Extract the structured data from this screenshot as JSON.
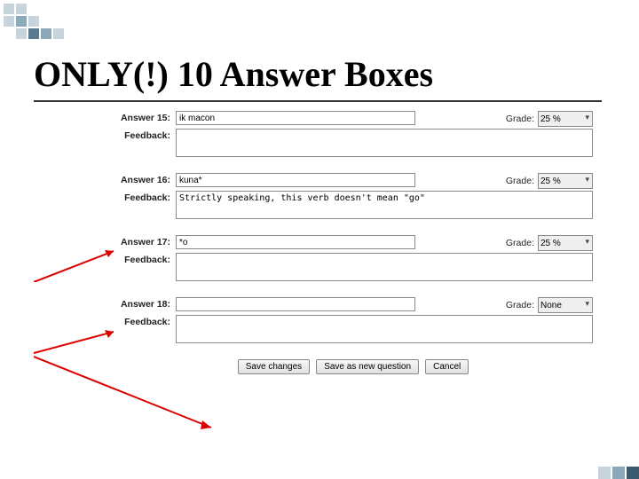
{
  "slide": {
    "title": "ONLY(!) 10 Answer Boxes"
  },
  "labels": {
    "answer_prefix": "Answer",
    "feedback": "Feedback:",
    "grade": "Grade:"
  },
  "answers": [
    {
      "num": "15",
      "label": "Answer 15:",
      "value": "ik macon",
      "grade": "25 %",
      "feedback": ""
    },
    {
      "num": "16",
      "label": "Answer 16:",
      "value": "kuna*",
      "grade": "25 %",
      "feedback": "Strictly speaking, this verb doesn't mean \"go\""
    },
    {
      "num": "17",
      "label": "Answer 17:",
      "value": "*o",
      "grade": "25 %",
      "feedback": ""
    },
    {
      "num": "18",
      "label": "Answer 18:",
      "value": "",
      "grade": "None",
      "feedback": ""
    }
  ],
  "buttons": {
    "save": "Save changes",
    "save_new": "Save as new question",
    "cancel": "Cancel"
  }
}
